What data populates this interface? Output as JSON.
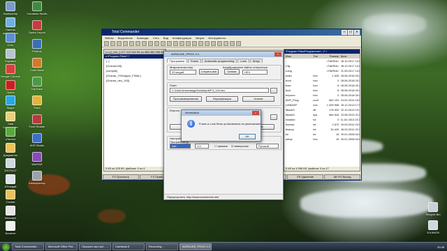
{
  "desktop": {
    "icons_left": [
      {
        "label": "Компьютер",
        "color": "#7a9cc6"
      },
      {
        "label": "Панель управления",
        "color": "#6fb2e0"
      },
      {
        "label": "Сеть",
        "color": "#5a8fd6"
      },
      {
        "label": "Корзина",
        "color": "#b8c4cf"
      },
      {
        "label": "Google Chrome",
        "color": "#d9403a"
      },
      {
        "label": "Opera",
        "color": "#cc1e1e"
      },
      {
        "label": "Skype",
        "color": "#27a8e0"
      },
      {
        "label": "Total Commander",
        "color": "#e6d27a"
      },
      {
        "label": "uTorrent",
        "color": "#5aa83c"
      },
      {
        "label": "Документы",
        "color": "#e8c35a"
      },
      {
        "label": "20070427",
        "color": "#cfd8e0"
      },
      {
        "label": "ATmega8",
        "color": "#dde3ea"
      },
      {
        "label": "Схемы",
        "color": "#e8c35a"
      },
      {
        "label": "Inkscape",
        "color": "#e5e5e5"
      },
      {
        "label": "Блокнот",
        "color": "#f0f0f0"
      }
    ],
    "icons_col2": [
      {
        "label": "Camtasia Studio",
        "color": "#3f8a3f"
      },
      {
        "label": "Sprint-Layout",
        "color": "#c43c3c"
      },
      {
        "label": "Proteus",
        "color": "#3a6fb8"
      },
      {
        "label": "CodeVision",
        "color": "#d07a2a"
      },
      {
        "label": "DipTrace",
        "color": "#4a9a4a"
      },
      {
        "label": "Paint",
        "color": "#e1b53a"
      },
      {
        "label": "Foxit Reader",
        "color": "#b83a3a"
      },
      {
        "label": "AVR Studio",
        "color": "#3b6fc8"
      },
      {
        "label": "WinRAR",
        "color": "#8a4ab8"
      },
      {
        "label": "Калькулятор",
        "color": "#9aa3ab"
      }
    ],
    "icons_right": [
      {
        "label": "Recycle Bin",
        "color": "#c7d0d8"
      },
      {
        "label": "20150629",
        "color": "#d0d8df"
      }
    ]
  },
  "total_commander": {
    "title": "Total Commander",
    "menu": [
      "Файлы",
      "Выделение",
      "Команды",
      "Сеть",
      "Вид",
      "Конфигурация",
      "Запуск",
      "Инструменты"
    ],
    "left_panel": {
      "header": "[-c-]  [_нет_]  127 119 040 Кб из 488 383 996 Кб свободно",
      "path": "c:\\Program Files\\*.*",
      "items": [
        "[..]",
        "[Gusnar145]",
        "[compile]",
        "[Gusnar_YSDragon_FINAL]",
        "[Gusnar_hex_145]"
      ],
      "footer": "0 Кб из 325 Кб, файлов: 0 из 4"
    },
    "right_panel": {
      "header": "\\Program Files\\Programmer\\...\\*.*",
      "columns": [
        "Имя",
        "Тип",
        "Размер",
        "Дата"
      ],
      "rows": [
        {
          "name": "..",
          "ext": "",
          "size": "<ПАПКА>",
          "date": "08.10.2017 10:05"
        },
        {
          "name": "Cfg",
          "ext": "",
          "size": "<ПАПКА>",
          "date": "08.10.2017 10:05"
        },
        {
          "name": "Lang",
          "ext": "",
          "size": "<ПАПКА>",
          "date": "01.05.2017 14:08"
        },
        {
          "name": "main",
          "ext": "hex",
          "size": "1 526",
          "date": "28.06.2018 20:24"
        },
        {
          "name": "boot",
          "ext": "hex",
          "size": "0",
          "date": "28.06.2018 20:24"
        },
        {
          "name": "fuse",
          "ext": "hex",
          "size": "8",
          "date": "28.06.2018 20:24"
        },
        {
          "name": "lock",
          "ext": "hex",
          "size": "8",
          "date": "28.06.2018 20:24"
        },
        {
          "name": "eeprom",
          "ext": "hex",
          "size": "0",
          "date": "28.06.2018 20:24"
        },
        {
          "name": "AVR_Prog",
          "ext": "conf",
          "size": "562 191",
          "date": "24.02.2014 15:57"
        },
        {
          "name": "USBASP",
          "ext": "exe",
          "size": "1 539 968",
          "date": "05.12.2013 17:54"
        },
        {
          "name": "libusb0",
          "ext": "dll",
          "size": "176 902",
          "date": "02.10.2013 19:41"
        },
        {
          "name": "libusb0",
          "ext": "sys",
          "size": "684 544",
          "date": "03.08.2013 21:56"
        },
        {
          "name": "readme",
          "ext": "txt",
          "size": "0",
          "date": "11.02.2013 22:35"
        },
        {
          "name": "license",
          "ext": "txt",
          "size": "2 672",
          "date": "09.09.2012 22:59"
        },
        {
          "name": "history",
          "ext": "txt",
          "size": "34 402",
          "date": "08.03.2012 22:56"
        },
        {
          "name": "ini",
          "ext": "ini",
          "size": "15",
          "date": "09.01.2008 04:03"
        },
        {
          "name": "setup",
          "ext": "hex",
          "size": "15",
          "date": "09.01.2008 04:03"
        }
      ],
      "footer": "0 Кб из 3 096 Кб, файлов: 0 из 17"
    },
    "fkeys": [
      "F3 Просмотр",
      "F4 Правка",
      "F5 Копирование",
      "F6 Перемещение",
      "F7 Каталог",
      "F8 Удаление",
      "Alt+F4 Выход"
    ]
  },
  "programmer": {
    "title": "AVRDUDE_PROG 3.3",
    "tabs": [
      "Программа",
      "Fuses",
      "Automatic programming",
      "Lock",
      "Шнур"
    ],
    "mcu_label": "Микроконтроллер",
    "mcu_value": "ATmega8",
    "read_button": "Стереть всё",
    "fuse_label": "Калибровочные байты генератора",
    "fuse_read": "Чтение",
    "fuse_hex": "HEX",
    "flash_label": "Flash",
    "flash_path": "C:\\User\\Александр\\Desktop\\MP3_128.hex",
    "flash_buttons": [
      "Программирование",
      "Верификация",
      "Чтение"
    ],
    "eeprom_label": "Eeprom",
    "eeprom_button": "Чтение",
    "settings_label": "Настройки",
    "settings_prog_label": "Программатор",
    "settings_port_value": "usb",
    "settings_speed_value": "1.5",
    "settings_check_inverse": "прямые",
    "settings_check_inverted": "инверсные",
    "settings_lang_value": "Русский",
    "status": "Переустроить: http://www.avrcisrecis.net/"
  },
  "dialog": {
    "title": "Information",
    "message": "Fuses и Lock биты установлены по умолчанию!",
    "ok": "OK"
  },
  "taskbar": {
    "buttons": [
      "Total Commander...",
      "Microsoft Office Pict...",
      "Прошить мк.mp4 - ...",
      "Camtasia 8",
      "Recording...",
      "AVRDUDE_PROG 3.3"
    ],
    "active_index": 5,
    "clock": "20:38"
  }
}
